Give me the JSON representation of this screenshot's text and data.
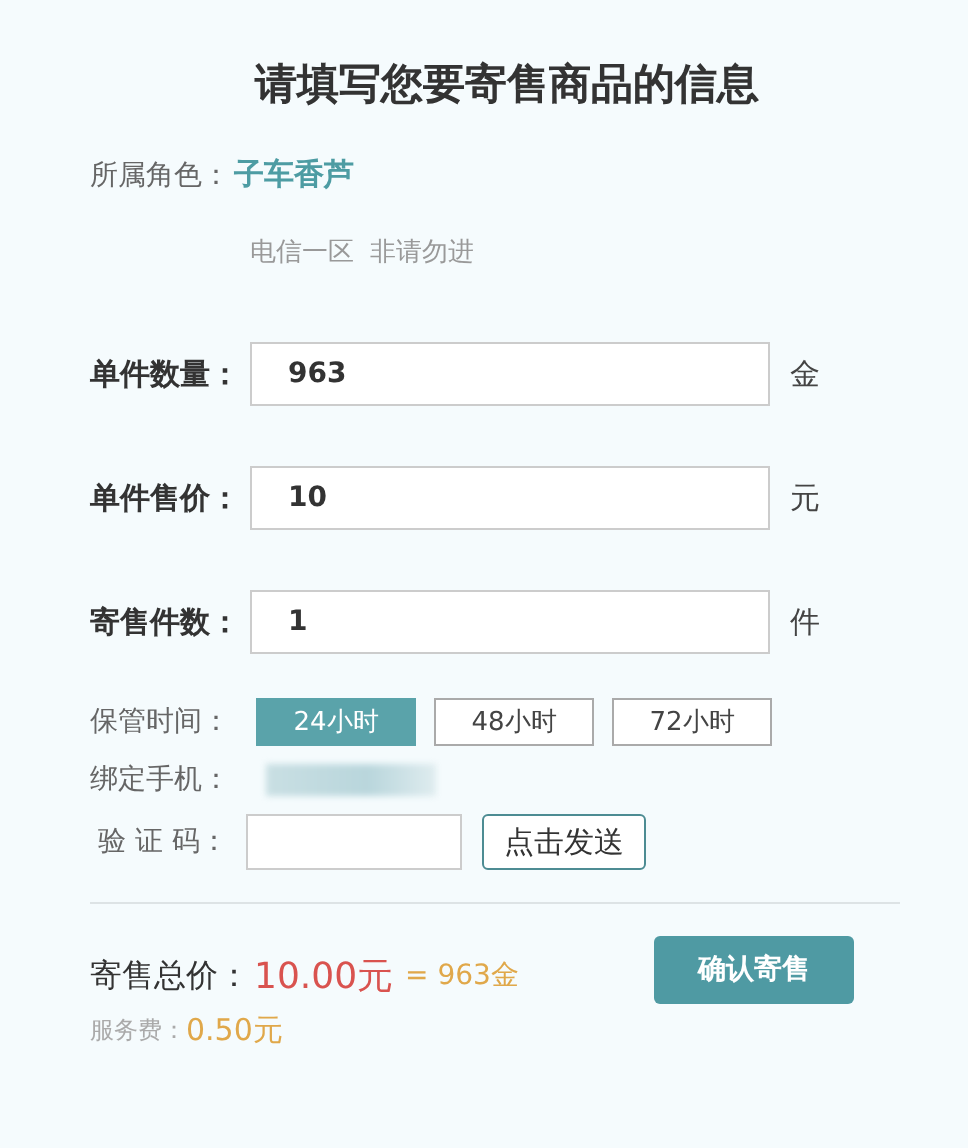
{
  "title": "请填写您要寄售商品的信息",
  "role": {
    "label": "所属角色：",
    "value": "子车香芦",
    "server": [
      "电信一区",
      "非请勿进"
    ]
  },
  "fields": [
    {
      "label": "单件数量：",
      "value": "963",
      "unit": "金"
    },
    {
      "label": "单件售价：",
      "value": "10",
      "unit": "元"
    },
    {
      "label": "寄售件数：",
      "value": "1",
      "unit": "件"
    }
  ],
  "storage": {
    "label": "保管时间：",
    "options": [
      {
        "label": "24小时",
        "selected": true
      },
      {
        "label": "48小时",
        "selected": false
      },
      {
        "label": "72小时",
        "selected": false
      }
    ]
  },
  "phone": {
    "label": "绑定手机："
  },
  "code": {
    "label": "验 证 码：",
    "button": "点击发送"
  },
  "total": {
    "label": "寄售总价：",
    "price": "10.00元",
    "equals": "= 963金"
  },
  "fee": {
    "label": "服务费：",
    "value": "0.50元"
  },
  "submit": "确认寄售"
}
